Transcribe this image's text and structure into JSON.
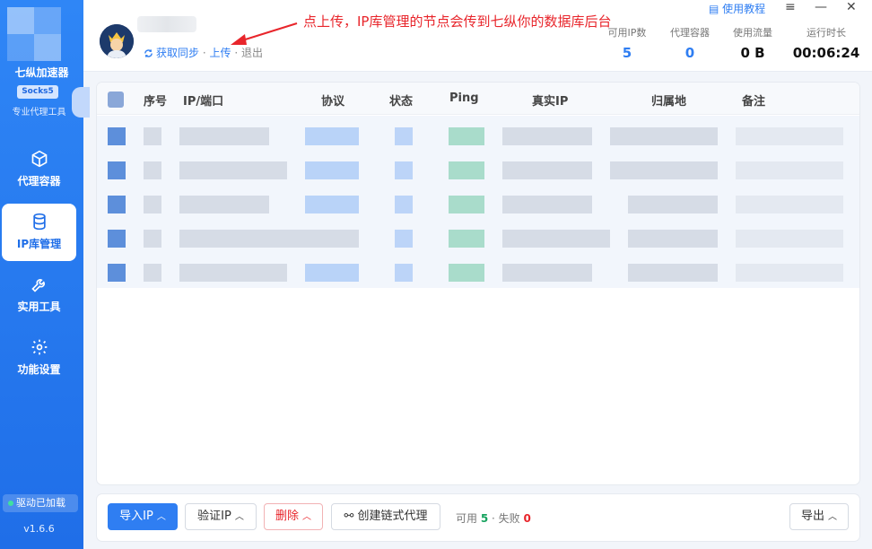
{
  "app": {
    "name": "七纵加速器",
    "protocol_badge": "Socks5",
    "subtitle": "专业代理工具",
    "version": "v1.6.6"
  },
  "sidebar": {
    "items": [
      {
        "label": "代理容器",
        "icon": "cube-icon",
        "active": false
      },
      {
        "label": "IP库管理",
        "icon": "database-icon",
        "active": true
      },
      {
        "label": "实用工具",
        "icon": "wrench-icon",
        "active": false
      },
      {
        "label": "功能设置",
        "icon": "gear-icon",
        "active": false
      }
    ],
    "driver_status": "驱动已加载"
  },
  "header": {
    "links": {
      "sync": "获取同步",
      "upload": "上传",
      "logout": "退出",
      "separator": "·"
    },
    "annotation": "点上传，IP库管理的节点会传到七纵你的数据库后台",
    "tutorial": "使用教程",
    "stats": [
      {
        "label": "可用IP数",
        "value": "5",
        "style": "blue"
      },
      {
        "label": "代理容器",
        "value": "0",
        "style": "blue"
      },
      {
        "label": "使用流量",
        "value": "0 B",
        "style": "dark"
      },
      {
        "label": "运行时长",
        "value": "00:06:24",
        "style": "dark"
      }
    ],
    "window": {
      "menu": "≡",
      "minimize": "—",
      "close": "✕"
    }
  },
  "table": {
    "columns": [
      "序号",
      "IP/端口",
      "协议",
      "状态",
      "Ping",
      "真实IP",
      "归属地",
      "备注"
    ],
    "row_count": 5
  },
  "footer": {
    "import_label": "导入IP",
    "verify_label": "验证IP",
    "delete_label": "删除",
    "chain_label": "创建链式代理",
    "export_label": "导出",
    "summary": {
      "ok_label": "可用",
      "ok_count": "5",
      "sep": " · ",
      "fail_label": "失败",
      "fail_count": "0"
    }
  },
  "colors": {
    "accent": "#2f7ef2",
    "danger": "#e8252b",
    "success": "#17a35f",
    "sidebar": "#1f6ee8"
  }
}
